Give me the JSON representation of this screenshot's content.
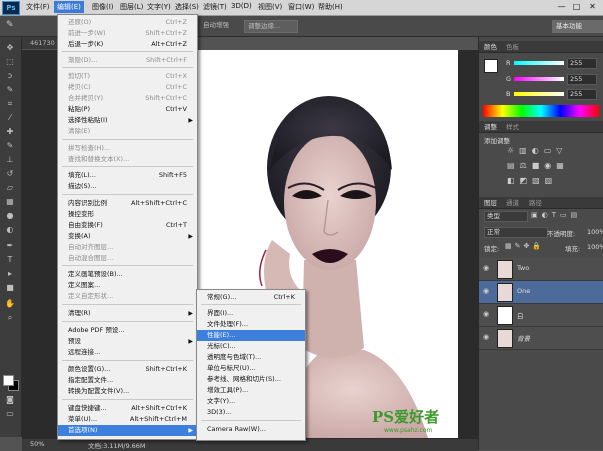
{
  "colors": {
    "menubar": "#d6d6d6",
    "highlight": "#3c7fdc",
    "panel": "#4a4a4a"
  },
  "app": {
    "logo": "Ps"
  },
  "menubar": {
    "items": [
      "文件(F)",
      "编辑(E)",
      "图像(I)",
      "图层(L)",
      "文字(Y)",
      "选择(S)",
      "滤镜(T)",
      "3D(D)",
      "视图(V)",
      "窗口(W)",
      "帮助(H)"
    ],
    "window_controls": [
      "—",
      "□",
      "✕"
    ]
  },
  "optionsbar": {
    "auto_enhance": "自动增强",
    "refine_edge": "调整边缘...",
    "workspace": "基本功能"
  },
  "doc_tab": "461730",
  "status": {
    "zoom": "50%",
    "doc": "文档:3.11M/9.66M"
  },
  "edit_menu": [
    {
      "label": "还原(O)",
      "shortcut": "Ctrl+Z"
    },
    {
      "label": "前进一步(W)",
      "shortcut": "Shift+Ctrl+Z"
    },
    {
      "label": "后退一步(K)",
      "shortcut": "Alt+Ctrl+Z"
    },
    {
      "label": "渐隐(D)...",
      "shortcut": "Shift+Ctrl+F"
    },
    {
      "label": "剪切(T)",
      "shortcut": "Ctrl+X"
    },
    {
      "label": "拷贝(C)",
      "shortcut": "Ctrl+C"
    },
    {
      "label": "合并拷贝(Y)",
      "shortcut": "Shift+Ctrl+C"
    },
    {
      "label": "粘贴(P)",
      "shortcut": "Ctrl+V"
    },
    {
      "label": "选择性粘贴(I)",
      "shortcut": ""
    },
    {
      "label": "清除(E)",
      "shortcut": ""
    },
    {
      "label": "拼写检查(H)...",
      "shortcut": ""
    },
    {
      "label": "查找和替换文本(X)...",
      "shortcut": ""
    },
    {
      "label": "填充(L)...",
      "shortcut": "Shift+F5"
    },
    {
      "label": "描边(S)...",
      "shortcut": ""
    },
    {
      "label": "内容识别比例",
      "shortcut": "Alt+Shift+Ctrl+C"
    },
    {
      "label": "操控变形",
      "shortcut": ""
    },
    {
      "label": "自由变换(F)",
      "shortcut": "Ctrl+T"
    },
    {
      "label": "变换(A)",
      "shortcut": ""
    },
    {
      "label": "自动对齐图层...",
      "shortcut": ""
    },
    {
      "label": "自动混合图层...",
      "shortcut": ""
    },
    {
      "label": "定义画笔预设(B)...",
      "shortcut": ""
    },
    {
      "label": "定义图案...",
      "shortcut": ""
    },
    {
      "label": "定义自定形状...",
      "shortcut": ""
    },
    {
      "label": "清理(R)",
      "shortcut": ""
    },
    {
      "label": "Adobe PDF 预设...",
      "shortcut": ""
    },
    {
      "label": "预设",
      "shortcut": ""
    },
    {
      "label": "远程连接...",
      "shortcut": ""
    },
    {
      "label": "颜色设置(G)...",
      "shortcut": "Shift+Ctrl+K"
    },
    {
      "label": "指定配置文件...",
      "shortcut": ""
    },
    {
      "label": "转换为配置文件(V)...",
      "shortcut": ""
    },
    {
      "label": "键盘快捷键...",
      "shortcut": "Alt+Shift+Ctrl+K"
    },
    {
      "label": "菜单(U)...",
      "shortcut": "Alt+Shift+Ctrl+M"
    },
    {
      "label": "首选项(N)",
      "shortcut": ""
    }
  ],
  "pref_menu": [
    {
      "label": "常规(G)...",
      "shortcut": "Ctrl+K"
    },
    {
      "label": "界面(I)...",
      "shortcut": ""
    },
    {
      "label": "文件处理(F)...",
      "shortcut": ""
    },
    {
      "label": "性能(E)...",
      "shortcut": ""
    },
    {
      "label": "光标(C)...",
      "shortcut": ""
    },
    {
      "label": "透明度与色域(T)...",
      "shortcut": ""
    },
    {
      "label": "单位与标尺(U)...",
      "shortcut": ""
    },
    {
      "label": "参考线、网格和切片(S)...",
      "shortcut": ""
    },
    {
      "label": "增效工具(P)...",
      "shortcut": ""
    },
    {
      "label": "文字(Y)...",
      "shortcut": ""
    },
    {
      "label": "3D(3)...",
      "shortcut": ""
    },
    {
      "label": "Camera Raw(W)...",
      "shortcut": ""
    }
  ],
  "color_panel": {
    "tabs": [
      "颜色",
      "色板"
    ],
    "channels": [
      {
        "name": "R",
        "value": "255"
      },
      {
        "name": "G",
        "value": "255"
      },
      {
        "name": "B",
        "value": "255"
      }
    ]
  },
  "adjust_panel": {
    "tabs": [
      "调整",
      "样式"
    ],
    "add_label": "添加调整"
  },
  "layers_panel": {
    "tabs": [
      "图层",
      "通道",
      "路径"
    ],
    "kind": "类型",
    "blend": "正常",
    "opacity_label": "不透明度:",
    "opacity": "100%",
    "lock_label": "锁定:",
    "fill_label": "填充:",
    "fill": "100%",
    "layers": [
      {
        "name": "Two"
      },
      {
        "name": "One"
      },
      {
        "name": "白"
      },
      {
        "name": "背景"
      }
    ]
  },
  "watermark": {
    "brand": "PS爱好者",
    "url": "www.psahz.com"
  }
}
